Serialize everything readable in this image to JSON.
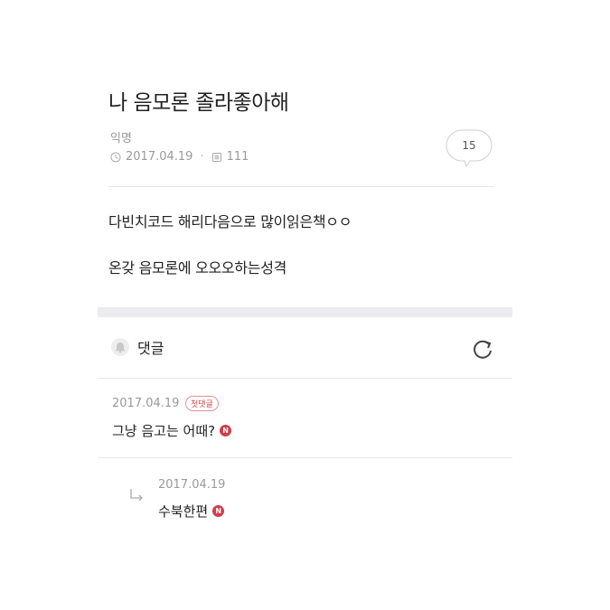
{
  "post": {
    "title": "나 음모론 졸라좋아해",
    "author": "익명",
    "date": "2017.04.19",
    "views": "111",
    "comment_count": "15",
    "body": [
      "다빈치코드 해리다음으로 많이읽은책ㅇㅇ",
      "온갖 음모론에 오오오하는성격"
    ]
  },
  "comments_section": {
    "header_label": "댓글",
    "icons": {
      "bell": "bell-icon",
      "refresh": "refresh-icon"
    }
  },
  "comments": [
    {
      "date": "2017.04.19",
      "badge": "첫댓글",
      "text": "그냥 음고는 어때?",
      "new_badge": "N"
    }
  ],
  "replies": [
    {
      "date": "2017.04.19",
      "text": "수북한편",
      "new_badge": "N"
    }
  ],
  "colors": {
    "accent": "#d23d4a",
    "muted": "#9a9a9a",
    "band": "#ececef"
  }
}
